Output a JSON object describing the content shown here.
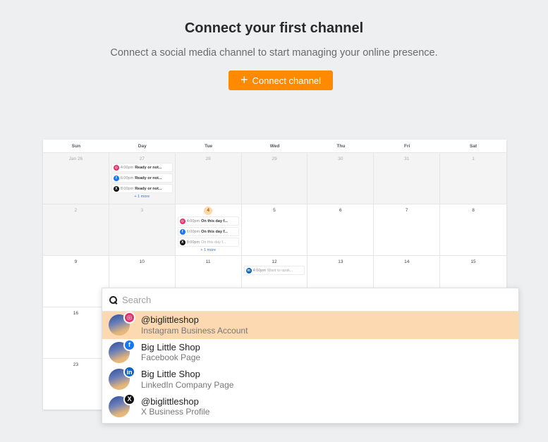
{
  "hero": {
    "title": "Connect your first channel",
    "subtitle": "Connect a social media channel to start managing your online presence.",
    "button_label": "Connect channel",
    "button_color": "#ff8a00"
  },
  "calendar": {
    "day_headers": [
      "Sun",
      "Day",
      "Tue",
      "Wed",
      "Thu",
      "Fri",
      "Sat"
    ],
    "rows": [
      {
        "dates": [
          "Jan 26",
          "27",
          "28",
          "29",
          "30",
          "31",
          "1"
        ],
        "posts_day": 1,
        "posts": [
          {
            "network": "instagram",
            "time": "4:00pm",
            "text": "Ready or not..."
          },
          {
            "network": "facebook",
            "time": "6:00pm",
            "text": "Ready or not..."
          },
          {
            "network": "x",
            "time": "8:00pm",
            "text": "Ready or not..."
          }
        ],
        "more": "+ 1 more"
      },
      {
        "dates": [
          "2",
          "3",
          "4",
          "5",
          "6",
          "7",
          "8"
        ],
        "posts_day": 2,
        "posts": [
          {
            "network": "instagram",
            "time": "4:00pm",
            "text": "On this day f..."
          },
          {
            "network": "facebook",
            "time": "6:00pm",
            "text": "On this day f..."
          },
          {
            "network": "x",
            "time": "8:00pm",
            "text": "On this day f..."
          }
        ],
        "more": "+ 1 more"
      },
      {
        "dates": [
          "9",
          "10",
          "11",
          "12",
          "13",
          "14",
          "15"
        ],
        "posts_day": 3,
        "posts": [
          {
            "network": "linkedin",
            "time": "4:00pm",
            "text": "Want to upsk..."
          }
        ]
      },
      {
        "dates": [
          "16",
          "",
          "",
          "",
          "",
          "",
          ""
        ]
      },
      {
        "dates": [
          "23",
          "",
          "",
          "",
          "",
          "",
          ""
        ]
      }
    ]
  },
  "picker": {
    "search_placeholder": "Search",
    "accounts": [
      {
        "name": "@biglittleshop",
        "type": "Instagram Business Account",
        "network": "instagram",
        "selected": true
      },
      {
        "name": "Big Little Shop",
        "type": "Facebook Page",
        "network": "facebook"
      },
      {
        "name": "Big Little Shop",
        "type": "LinkedIn Company Page",
        "network": "linkedin"
      },
      {
        "name": "@biglittleshop",
        "type": "X Business Profile",
        "network": "x"
      }
    ]
  },
  "network_icons": {
    "instagram": {
      "glyph": "◎",
      "class": "ig",
      "color": "#e1306c"
    },
    "facebook": {
      "glyph": "f",
      "class": "fb",
      "color": "#1877f2"
    },
    "linkedin": {
      "glyph": "in",
      "class": "li",
      "color": "#0a66c2"
    },
    "x": {
      "glyph": "X",
      "class": "xx",
      "color": "#111111"
    }
  }
}
